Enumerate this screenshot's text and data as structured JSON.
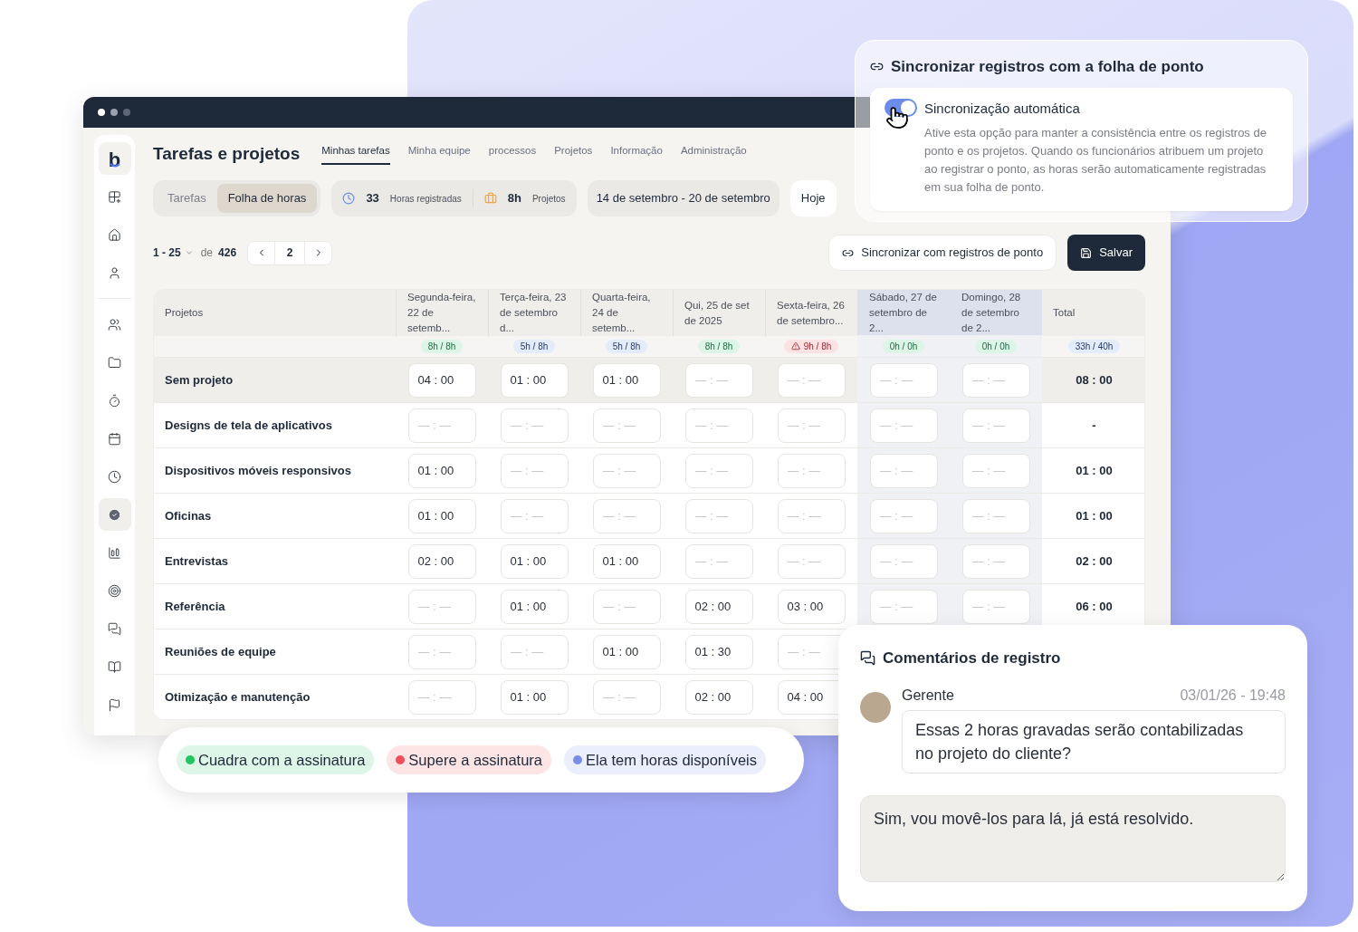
{
  "app_window": {
    "title": "Tarefas e projetos",
    "logo": "b",
    "nav_tabs": [
      {
        "label": "Minhas tarefas",
        "selected": true
      },
      {
        "label": "Minha equipe",
        "selected": false
      },
      {
        "label": "processos",
        "selected": false
      },
      {
        "label": "Projetos",
        "selected": false
      },
      {
        "label": "Informação",
        "selected": false
      },
      {
        "label": "Administração",
        "selected": false
      }
    ],
    "sidebar": [
      {
        "selected": false
      },
      {
        "selected": false
      },
      {
        "selected": false
      },
      {
        "selected": false
      },
      {
        "selected": false
      },
      {
        "selected": false
      },
      {
        "selected": false
      },
      {
        "selected": false
      },
      {
        "selected": true
      },
      {
        "selected": false
      },
      {
        "selected": false
      },
      {
        "selected": false
      },
      {
        "selected": false
      },
      {
        "selected": false
      }
    ],
    "view_switch": [
      {
        "label": "Tarefas",
        "selected": false
      },
      {
        "label": "Folha de horas",
        "selected": true
      }
    ],
    "stats": [
      {
        "value": "33",
        "label": "Horas registradas"
      },
      {
        "value": "8h",
        "label": "Projetos"
      }
    ],
    "date_range": "14 de setembro - 20 de setembro",
    "today_button": "Hoje",
    "pagination": {
      "range": "1 - 25",
      "of": "de",
      "total": "426",
      "page": "2"
    },
    "sync_button": "Sincronizar com registros de ponto",
    "save_button": "Salvar",
    "table": {
      "columns": [
        {
          "label": "Projetos",
          "weekend": false
        },
        {
          "label": "Segunda-feira, 22 de setemb...",
          "badge": "8h / 8h",
          "kind": "ok",
          "weekend": false
        },
        {
          "label": "Terça-feira, 23 de setembro d...",
          "badge": "5h / 8h",
          "kind": "under",
          "weekend": false
        },
        {
          "label": "Quarta-feira, 24 de setemb...",
          "badge": "5h / 8h",
          "kind": "under",
          "weekend": false
        },
        {
          "label": "Qui, 25 de set de 2025",
          "badge": "8h / 8h",
          "kind": "ok",
          "weekend": false
        },
        {
          "label": "Sexta-feira, 26 de setembro...",
          "badge": "9h / 8h",
          "kind": "over",
          "weekend": false
        },
        {
          "label": "Sábado, 27 de setembro de 2...",
          "badge": "0h / 0h",
          "kind": "ok",
          "weekend": true
        },
        {
          "label": "Domingo, 28 de setembro de 2...",
          "badge": "0h / 0h",
          "kind": "ok",
          "weekend": true
        },
        {
          "label": "Total",
          "badge": "33h / 40h",
          "kind": "under",
          "weekend": false
        }
      ],
      "rows": [
        {
          "selected": true,
          "cells": [
            {
              "kind": "name",
              "text": "Sem projeto"
            },
            {
              "kind": "time",
              "value": "04 : 00"
            },
            {
              "kind": "time",
              "value": "01 : 00"
            },
            {
              "kind": "time",
              "value": "01 : 00"
            },
            {
              "kind": "time",
              "placeholder": "— : —"
            },
            {
              "kind": "time",
              "placeholder": "— : —"
            },
            {
              "kind": "time",
              "placeholder": "— : —"
            },
            {
              "kind": "time",
              "placeholder": "— : —"
            },
            {
              "kind": "total",
              "text": "08 : 00"
            }
          ]
        },
        {
          "selected": false,
          "cells": [
            {
              "kind": "name",
              "text": "Designs de tela de aplicativos"
            },
            {
              "kind": "time",
              "placeholder": "— : —"
            },
            {
              "kind": "time",
              "placeholder": "— : —"
            },
            {
              "kind": "time",
              "placeholder": "— : —"
            },
            {
              "kind": "time",
              "placeholder": "— : —"
            },
            {
              "kind": "time",
              "placeholder": "— : —"
            },
            {
              "kind": "time",
              "placeholder": "— : —"
            },
            {
              "kind": "time",
              "placeholder": "— : —"
            },
            {
              "kind": "total",
              "text": "-"
            }
          ]
        },
        {
          "selected": false,
          "cells": [
            {
              "kind": "name",
              "text": "Dispositivos móveis responsivos"
            },
            {
              "kind": "time",
              "value": "01 : 00"
            },
            {
              "kind": "time",
              "placeholder": "— : —"
            },
            {
              "kind": "time",
              "placeholder": "— : —"
            },
            {
              "kind": "time",
              "placeholder": "— : —"
            },
            {
              "kind": "time",
              "placeholder": "— : —"
            },
            {
              "kind": "time",
              "placeholder": "— : —"
            },
            {
              "kind": "time",
              "placeholder": "— : —"
            },
            {
              "kind": "total",
              "text": "01 : 00"
            }
          ]
        },
        {
          "selected": false,
          "cells": [
            {
              "kind": "name",
              "text": "Oficinas"
            },
            {
              "kind": "time",
              "value": "01 : 00"
            },
            {
              "kind": "time",
              "placeholder": "— : —"
            },
            {
              "kind": "time",
              "placeholder": "— : —"
            },
            {
              "kind": "time",
              "placeholder": "— : —"
            },
            {
              "kind": "time",
              "placeholder": "— : —"
            },
            {
              "kind": "time",
              "placeholder": "— : —"
            },
            {
              "kind": "time",
              "placeholder": "— : —"
            },
            {
              "kind": "total",
              "text": "01 : 00"
            }
          ]
        },
        {
          "selected": false,
          "cells": [
            {
              "kind": "name",
              "text": "Entrevistas"
            },
            {
              "kind": "time",
              "value": "02 : 00"
            },
            {
              "kind": "time",
              "value": "01 : 00"
            },
            {
              "kind": "time",
              "value": "01 : 00"
            },
            {
              "kind": "time",
              "placeholder": "— : —"
            },
            {
              "kind": "time",
              "placeholder": "— : —"
            },
            {
              "kind": "time",
              "placeholder": "— : —"
            },
            {
              "kind": "time",
              "placeholder": "— : —"
            },
            {
              "kind": "total",
              "text": "02 : 00"
            }
          ]
        },
        {
          "selected": false,
          "cells": [
            {
              "kind": "name",
              "text": "Referência"
            },
            {
              "kind": "time",
              "placeholder": "— : —"
            },
            {
              "kind": "time",
              "value": "01 : 00"
            },
            {
              "kind": "time",
              "placeholder": "— : —"
            },
            {
              "kind": "time",
              "value": "02 : 00"
            },
            {
              "kind": "time",
              "value": "03 : 00"
            },
            {
              "kind": "time",
              "placeholder": "— : —"
            },
            {
              "kind": "time",
              "placeholder": "— : —"
            },
            {
              "kind": "total",
              "text": "06 : 00"
            }
          ]
        },
        {
          "selected": false,
          "cells": [
            {
              "kind": "name",
              "text": "Reuniões de equipe"
            },
            {
              "kind": "time",
              "placeholder": "— : —"
            },
            {
              "kind": "time",
              "placeholder": "— : —"
            },
            {
              "kind": "time",
              "value": "01 : 00"
            },
            {
              "kind": "time",
              "value": "01 : 30"
            },
            {
              "kind": "time",
              "placeholder": "— : —"
            }
          ]
        },
        {
          "selected": false,
          "cells": [
            {
              "kind": "name",
              "text": "Otimização e manutenção"
            },
            {
              "kind": "time",
              "placeholder": "— : —"
            },
            {
              "kind": "time",
              "value": "01 : 00"
            },
            {
              "kind": "time",
              "placeholder": "— : —"
            },
            {
              "kind": "time",
              "value": "02 : 00"
            },
            {
              "kind": "time",
              "value": "04 : 00"
            }
          ]
        }
      ]
    }
  },
  "legend": [
    {
      "label": "Cuadra com a assinatura",
      "color": "#22c55e"
    },
    {
      "label": "Supere a assinatura",
      "color": "#ef4f5a"
    },
    {
      "label": "Ela tem horas disponíveis",
      "color": "#7b8ce8"
    }
  ],
  "sync_card": {
    "title": "Sincronizar registros com a folha de ponto",
    "toggle": {
      "label": "Sincronização automática",
      "on": true,
      "description": "Ative esta opção para manter a consistência entre os registros de ponto e os projetos. Quando os funcionários atribuem um projeto ao registrar o ponto, as horas serão automaticamente registradas em sua folha de ponto."
    }
  },
  "comments_card": {
    "title": "Comentários de registro",
    "comments": [
      {
        "author": "Gerente",
        "time": "03/01/26 - 19:48",
        "text": "Essas 2 horas gravadas serão contabilizadas no projeto do cliente?"
      }
    ],
    "reply": {
      "value": "Sim, vou movê-los para lá, já está resolvido."
    }
  }
}
